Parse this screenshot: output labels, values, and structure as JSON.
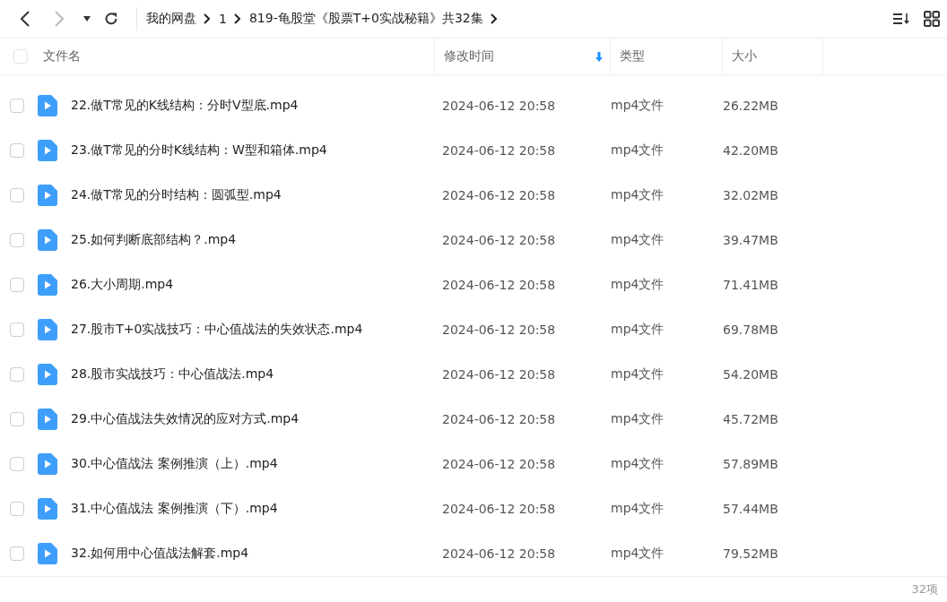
{
  "breadcrumb": [
    "我的网盘",
    "1",
    "819-龟股堂《股票T+0实战秘籍》共32集"
  ],
  "select_all": {
    "checked": false
  },
  "columns": [
    {
      "label": "文件名"
    },
    {
      "label": "修改时间",
      "sorted": true
    },
    {
      "label": "类型"
    },
    {
      "label": "大小"
    }
  ],
  "rows": [
    {
      "name": "22.做T常见的K线结构：分时V型底.mp4",
      "modified": "2024-06-12 20:58",
      "type": "mp4文件",
      "size": "26.22MB",
      "checked": false
    },
    {
      "name": "23.做T常见的分时K线结构：W型和箱体.mp4",
      "modified": "2024-06-12 20:58",
      "type": "mp4文件",
      "size": "42.20MB",
      "checked": false
    },
    {
      "name": "24.做T常见的分时结构：圆弧型.mp4",
      "modified": "2024-06-12 20:58",
      "type": "mp4文件",
      "size": "32.02MB",
      "checked": false
    },
    {
      "name": "25.如何判断底部结构？.mp4",
      "modified": "2024-06-12 20:58",
      "type": "mp4文件",
      "size": "39.47MB",
      "checked": false
    },
    {
      "name": "26.大小周期.mp4",
      "modified": "2024-06-12 20:58",
      "type": "mp4文件",
      "size": "71.41MB",
      "checked": false
    },
    {
      "name": "27.股市T+0实战技巧：中心值战法的失效状态.mp4",
      "modified": "2024-06-12 20:58",
      "type": "mp4文件",
      "size": "69.78MB",
      "checked": false
    },
    {
      "name": "28.股市实战技巧：中心值战法.mp4",
      "modified": "2024-06-12 20:58",
      "type": "mp4文件",
      "size": "54.20MB",
      "checked": false
    },
    {
      "name": "29.中心值战法失效情况的应对方式.mp4",
      "modified": "2024-06-12 20:58",
      "type": "mp4文件",
      "size": "45.72MB",
      "checked": false
    },
    {
      "name": "30.中心值战法 案例推演（上）.mp4",
      "modified": "2024-06-12 20:58",
      "type": "mp4文件",
      "size": "57.89MB",
      "checked": false
    },
    {
      "name": "31.中心值战法 案例推演（下）.mp4",
      "modified": "2024-06-12 20:58",
      "type": "mp4文件",
      "size": "57.44MB",
      "checked": false
    },
    {
      "name": "32.如何用中心值战法解套.mp4",
      "modified": "2024-06-12 20:58",
      "type": "mp4文件",
      "size": "79.52MB",
      "checked": false
    }
  ],
  "footer": {
    "count": "32项"
  }
}
